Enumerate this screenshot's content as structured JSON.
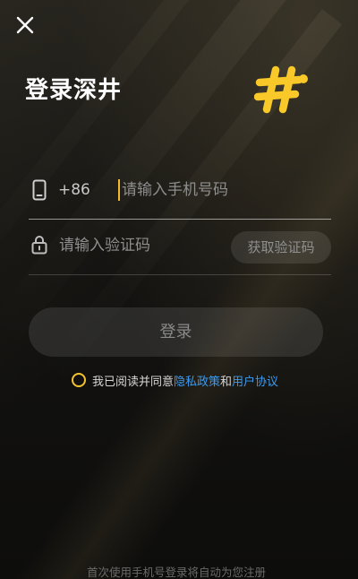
{
  "header": {
    "title": "登录深井",
    "close_icon": "close-icon",
    "logo_icon": "hashtag-logo-icon",
    "accent_color": "#f8c928"
  },
  "phone": {
    "country_code": "+86",
    "placeholder": "请输入手机号码",
    "value": "",
    "icon": "phone-icon",
    "caret_color": "#f5b82e"
  },
  "verification": {
    "placeholder": "请输入验证码",
    "value": "",
    "icon": "lock-icon",
    "get_code_label": "获取验证码"
  },
  "login": {
    "button_label": "登录"
  },
  "agreement": {
    "prefix": "我已阅读并同意",
    "privacy_link": "隐私政策",
    "joiner": "和",
    "terms_link": "用户协议",
    "checked": false,
    "link_color": "#3c9bf0",
    "radio_color": "#f5c32e"
  },
  "footer": {
    "note": "首次使用手机号登录将自动为您注册"
  }
}
